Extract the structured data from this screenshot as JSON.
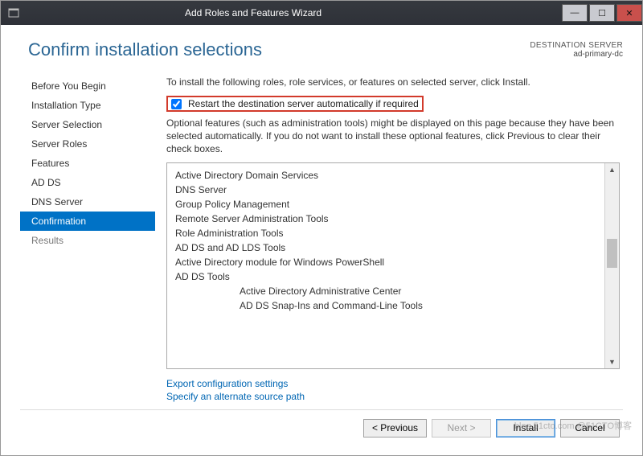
{
  "window": {
    "title": "Add Roles and Features Wizard"
  },
  "header": {
    "page_title": "Confirm installation selections",
    "destination_label": "DESTINATION SERVER",
    "destination_server": "ad-primary-dc"
  },
  "sidebar": {
    "steps": [
      {
        "label": "Before You Begin",
        "enabled": true,
        "active": false
      },
      {
        "label": "Installation Type",
        "enabled": true,
        "active": false
      },
      {
        "label": "Server Selection",
        "enabled": true,
        "active": false
      },
      {
        "label": "Server Roles",
        "enabled": true,
        "active": false
      },
      {
        "label": "Features",
        "enabled": true,
        "active": false
      },
      {
        "label": "AD DS",
        "enabled": true,
        "active": false
      },
      {
        "label": "DNS Server",
        "enabled": true,
        "active": false
      },
      {
        "label": "Confirmation",
        "enabled": true,
        "active": true
      },
      {
        "label": "Results",
        "enabled": false,
        "active": false
      }
    ]
  },
  "main": {
    "intro": "To install the following roles, role services, or features on selected server, click Install.",
    "restart_label": "Restart the destination server automatically if required",
    "restart_checked": true,
    "optional_text": "Optional features (such as administration tools) might be displayed on this page because they have been selected automatically. If you do not want to install these optional features, click Previous to clear their check boxes.",
    "features": [
      {
        "label": "Active Directory Domain Services",
        "indent": 0
      },
      {
        "label": "DNS Server",
        "indent": 0
      },
      {
        "label": "Group Policy Management",
        "indent": 0
      },
      {
        "label": "Remote Server Administration Tools",
        "indent": 0
      },
      {
        "label": "Role Administration Tools",
        "indent": 1
      },
      {
        "label": "AD DS and AD LDS Tools",
        "indent": 2
      },
      {
        "label": "Active Directory module for Windows PowerShell",
        "indent": 3
      },
      {
        "label": "AD DS Tools",
        "indent": 3
      },
      {
        "label": "Active Directory Administrative Center",
        "indent": 3,
        "extra_left": true
      },
      {
        "label": "AD DS Snap-Ins and Command-Line Tools",
        "indent": 3,
        "extra_left": true
      }
    ],
    "export_link": "Export configuration settings",
    "source_link": "Specify an alternate source path"
  },
  "footer": {
    "previous": "< Previous",
    "next": "Next >",
    "install": "Install",
    "cancel": "Cancel"
  },
  "watermark": "blog.51cto.com @51CTO博客"
}
